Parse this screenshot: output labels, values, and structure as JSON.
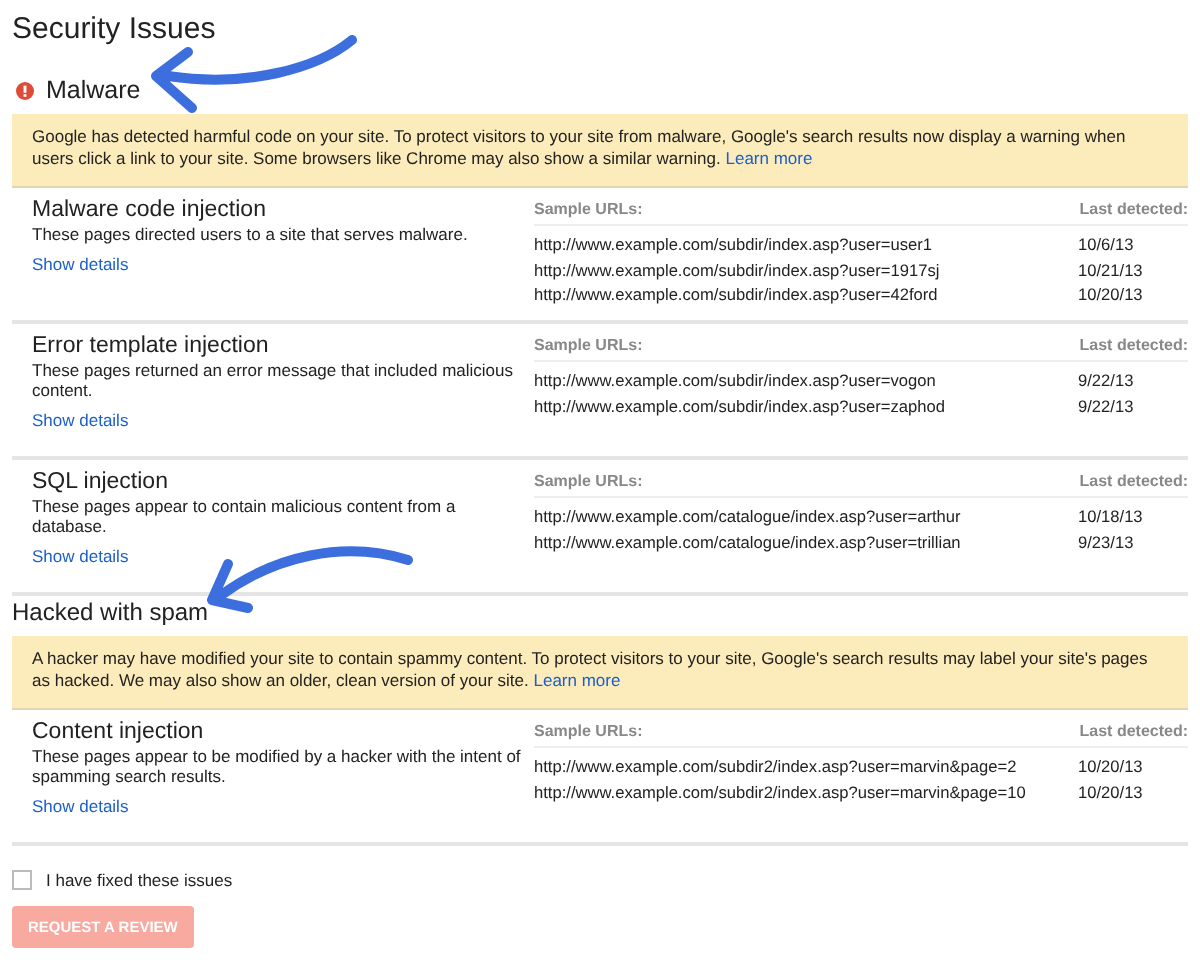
{
  "title": "Security Issues",
  "sections": [
    {
      "heading": "Malware",
      "alert_icon": true,
      "banner": {
        "text": "Google has detected harmful code on your site. To protect visitors to your site from malware, Google's search results now display a warning when users click a link to your site. Some browsers like Chrome may also show a similar warning.",
        "link": "Learn more"
      },
      "issues": [
        {
          "name": "Malware code injection",
          "description": "These pages directed users to a site that serves malware.",
          "details_link": "Show details",
          "urls_header": "Sample URLs:",
          "date_header": "Last detected:",
          "samples": [
            {
              "url": "http://www.example.com/subdir/index.asp?user=user1",
              "date": "10/6/13"
            },
            {
              "url": "http://www.example.com/subdir/index.asp?user=1917sj",
              "date": "10/21/13"
            },
            {
              "url": "http://www.example.com/subdir/index.asp?user=42ford",
              "date": "10/20/13"
            }
          ]
        },
        {
          "name": "Error template injection",
          "description": "These pages returned an error message that included malicious content.",
          "details_link": "Show details",
          "urls_header": "Sample URLs:",
          "date_header": "Last detected:",
          "samples": [
            {
              "url": "http://www.example.com/subdir/index.asp?user=vogon",
              "date": "9/22/13"
            },
            {
              "url": "http://www.example.com/subdir/index.asp?user=zaphod",
              "date": "9/22/13"
            }
          ]
        },
        {
          "name": "SQL injection",
          "description": "These pages appear to contain malicious content from a database.",
          "details_link": "Show details",
          "urls_header": "Sample URLs:",
          "date_header": "Last detected:",
          "samples": [
            {
              "url": "http://www.example.com/catalogue/index.asp?user=arthur",
              "date": "10/18/13"
            },
            {
              "url": "http://www.example.com/catalogue/index.asp?user=trillian",
              "date": "9/23/13"
            }
          ]
        }
      ]
    },
    {
      "heading": "Hacked with spam",
      "alert_icon": false,
      "banner": {
        "text": "A hacker may have modified your site to contain spammy content. To protect visitors to your site, Google's search results may label your site's pages as hacked. We may also show an older, clean version of your site.",
        "link": "Learn more"
      },
      "issues": [
        {
          "name": "Content injection",
          "description": "These pages appear to be modified by a hacker with the intent of spamming search results.",
          "details_link": "Show details",
          "urls_header": "Sample URLs:",
          "date_header": "Last detected:",
          "samples": [
            {
              "url": "http://www.example.com/subdir2/index.asp?user=marvin&page=2",
              "date": "10/20/13"
            },
            {
              "url": "http://www.example.com/subdir2/index.asp?user=marvin&page=10",
              "date": "10/20/13"
            }
          ]
        }
      ]
    }
  ],
  "fixed_checkbox": {
    "label": "I have fixed these issues",
    "checked": false
  },
  "review_button": {
    "label": "REQUEST A REVIEW",
    "disabled": true
  }
}
